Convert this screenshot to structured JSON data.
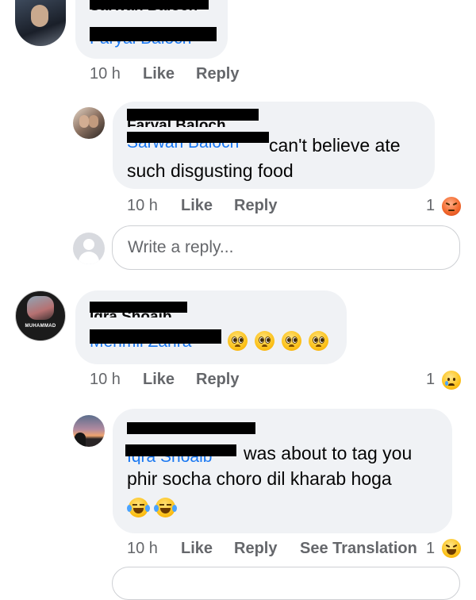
{
  "comments": [
    {
      "author_fragment": "Sarwan Baloch",
      "tag_fragment": "Faryal Baloch",
      "time": "10 h",
      "like": "Like",
      "reply": "Reply"
    },
    {
      "author_fragment": "Faryal Baloch",
      "tag_fragment": "Sarwan Baloch",
      "text_line1": "can't believe ate",
      "text_line2": "such disgusting food",
      "time": "10 h",
      "like": "Like",
      "reply": "Reply",
      "reaction_count": "1",
      "reaction_icon": "angry-reaction-icon"
    },
    {
      "author_fragment": "Iqra Shoaib",
      "tag_fragment": "Mehmil Zahra",
      "emoji": [
        "pleading-face-emoji",
        "pleading-face-emoji",
        "pleading-face-emoji",
        "pleading-face-emoji"
      ],
      "time": "10 h",
      "like": "Like",
      "reply": "Reply",
      "reaction_count": "1",
      "reaction_icon": "sad-reaction-icon",
      "avatar_text": "MUHAMMAD"
    },
    {
      "tag_fragment": "Iqra Shoaib",
      "text_line1": "was about to tag you",
      "text_line2": "phir socha choro dil kharab hoga",
      "emoji": [
        "tears-of-joy-emoji",
        "tears-of-joy-emoji"
      ],
      "time": "10 h",
      "like": "Like",
      "reply": "Reply",
      "see_translation": "See Translation",
      "reaction_count": "1",
      "reaction_icon": "haha-reaction-icon"
    }
  ],
  "write_reply": {
    "placeholder": "Write a reply..."
  },
  "colors": {
    "bubble": "#f0f2f5",
    "meta": "#65676b",
    "tag": "#1877f2"
  }
}
